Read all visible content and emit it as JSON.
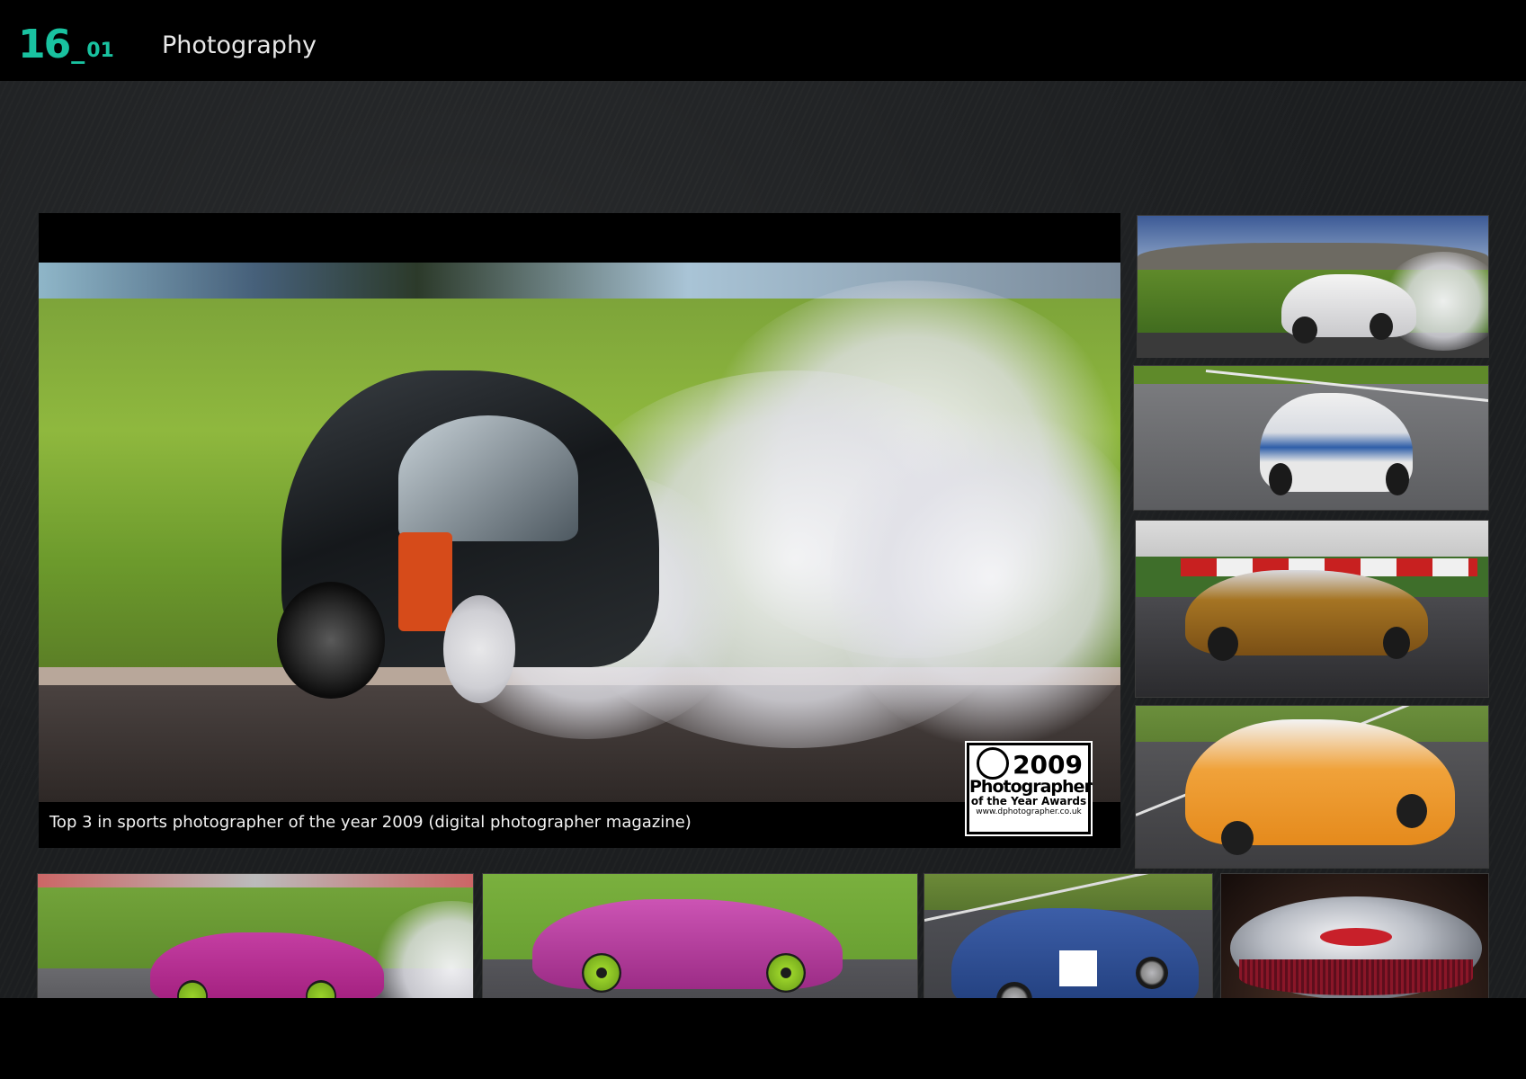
{
  "header": {
    "logo_major": "16",
    "logo_separator": "_",
    "logo_minor": "01",
    "title": "Photography"
  },
  "main_photo": {
    "caption": "Top 3 in sports photographer of the year 2009 (digital photographer magazine)",
    "award": {
      "year": "2009",
      "line1": "Photographer",
      "line2": "of the Year Awards",
      "url": "www.dphotographer.co.uk"
    }
  },
  "colors": {
    "accent": "#19c2a0",
    "background": "#1c1e20",
    "caption_text": "#f2f2f2"
  }
}
